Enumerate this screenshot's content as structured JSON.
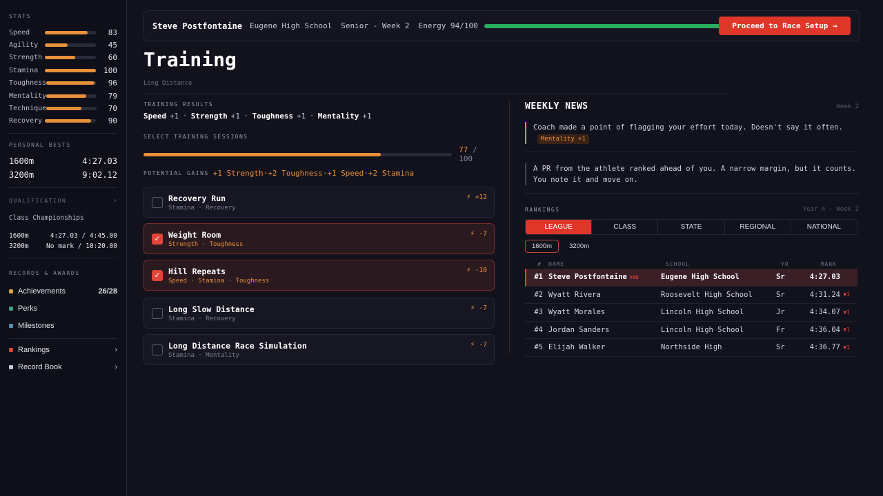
{
  "sidebar": {
    "stats_title": "STATS",
    "stats": [
      {
        "name": "Speed",
        "value": "83",
        "level": 0.83
      },
      {
        "name": "Agility",
        "value": "45",
        "level": 0.45
      },
      {
        "name": "Strength",
        "value": "60",
        "level": 0.6
      },
      {
        "name": "Stamina",
        "value": "100",
        "level": 1.0
      },
      {
        "name": "Toughness",
        "value": "96",
        "level": 0.96
      },
      {
        "name": "Mentality",
        "value": "79",
        "level": 0.79
      },
      {
        "name": "Technique",
        "value": "70",
        "level": 0.7
      },
      {
        "name": "Recovery",
        "value": "90",
        "level": 0.9
      }
    ],
    "pb_title": "PERSONAL BESTS",
    "personal_bests": [
      {
        "event": "1600m",
        "time": "4:27.03"
      },
      {
        "event": "3200m",
        "time": "9:02.12"
      }
    ],
    "qual_title": "QUALIFICATION",
    "qual_chevron": "›",
    "qual_meet": "Class Championships",
    "qualification": [
      {
        "event": "1600m",
        "mark": "4:27.03 / 4:45.00"
      },
      {
        "event": "3200m",
        "mark": "No mark / 10:20.00"
      }
    ],
    "records_title": "RECORDS & AWARDS",
    "records": [
      {
        "label": "Achievements",
        "value": "26/28",
        "color": "#d9a441"
      },
      {
        "label": "Perks",
        "value": "",
        "color": "#3fa37c"
      },
      {
        "label": "Milestones",
        "value": "",
        "color": "#5b8fb0"
      }
    ],
    "links": [
      {
        "label": "Rankings",
        "chevron": "›",
        "color": "#e0443a"
      },
      {
        "label": "Record Book",
        "chevron": "›",
        "color": "#c8c8d8"
      }
    ]
  },
  "header": {
    "athlete": "Steve Postfontaine",
    "school": "Eugene High School",
    "year_week": "Senior - Week 2",
    "energy_label": "Energy 94/100",
    "energy_level": 0.94,
    "proceed_label": "Proceed to Race Setup →"
  },
  "page": {
    "title": "Training",
    "subtitle": "Long Distance"
  },
  "training": {
    "results_title": "TRAINING RESULTS",
    "results": [
      {
        "stat": "Speed",
        "delta": "+1"
      },
      {
        "stat": "Strength",
        "delta": "+1"
      },
      {
        "stat": "Toughness",
        "delta": "+1"
      },
      {
        "stat": "Mentality",
        "delta": "+1"
      }
    ],
    "results_sep": "•",
    "select_title": "SELECT TRAINING SESSIONS",
    "selected": "77",
    "total": "/ 100",
    "session_level": 0.77,
    "gains_title": "POTENTIAL GAINS",
    "gains": "+1 Strength·+2 Toughness·+1 Speed·+2 Stamina",
    "sessions": [
      {
        "name": "Recovery Run",
        "tags": "Stamina · Recovery",
        "cost": "+12",
        "selected": false
      },
      {
        "name": "Weight Room",
        "tags": "Strength · Toughness",
        "cost": "-7",
        "selected": true
      },
      {
        "name": "Hill Repeats",
        "tags": "Speed · Stamina · Toughness",
        "cost": "-10",
        "selected": true
      },
      {
        "name": "Long Slow Distance",
        "tags": "Stamina · Recovery",
        "cost": "-7",
        "selected": false
      },
      {
        "name": "Long Distance Race Simulation",
        "tags": "Stamina · Mentality",
        "cost": "-7",
        "selected": false
      }
    ],
    "check": "✓",
    "bolt": "⚡"
  },
  "news": {
    "title": "WEEKLY NEWS",
    "week": "Week 2",
    "items": [
      {
        "text": "Coach made a point of flagging your effort today. Doesn't say it often.",
        "badge": "Mentality +1"
      },
      {
        "text": "A PR from the athlete ranked ahead of you. A narrow margin, but it counts. You note it and move on.",
        "badge": ""
      }
    ]
  },
  "rankings": {
    "title": "RANKINGS",
    "period": "Year 4 · Week 2",
    "tabs": [
      "LEAGUE",
      "CLASS",
      "STATE",
      "REGIONAL",
      "NATIONAL"
    ],
    "active_tab": 0,
    "distances": [
      "1600m",
      "3200m"
    ],
    "active_distance": 0,
    "columns": {
      "rank": "#",
      "name": "NAME",
      "school": "SCHOOL",
      "yr": "YR",
      "mark": "MARK"
    },
    "you_tag": "YOU",
    "down_arrow": "▼1",
    "rows": [
      {
        "rank": "#1",
        "name": "Steve Postfontaine",
        "school": "Eugene High School",
        "yr": "Sr",
        "mark": "4:27.03",
        "trend": "",
        "you": true
      },
      {
        "rank": "#2",
        "name": "Wyatt Rivera",
        "school": "Roosevelt High School",
        "yr": "Sr",
        "mark": "4:31.24",
        "trend": "▼1",
        "you": false
      },
      {
        "rank": "#3",
        "name": "Wyatt Morales",
        "school": "Lincoln High School",
        "yr": "Jr",
        "mark": "4:34.07",
        "trend": "▼1",
        "you": false
      },
      {
        "rank": "#4",
        "name": "Jordan Sanders",
        "school": "Lincoln High School",
        "yr": "Fr",
        "mark": "4:36.04",
        "trend": "▼1",
        "you": false
      },
      {
        "rank": "#5",
        "name": "Elijah Walker",
        "school": "Northside High",
        "yr": "Sr",
        "mark": "4:36.77",
        "trend": "▼1",
        "you": false
      }
    ]
  }
}
